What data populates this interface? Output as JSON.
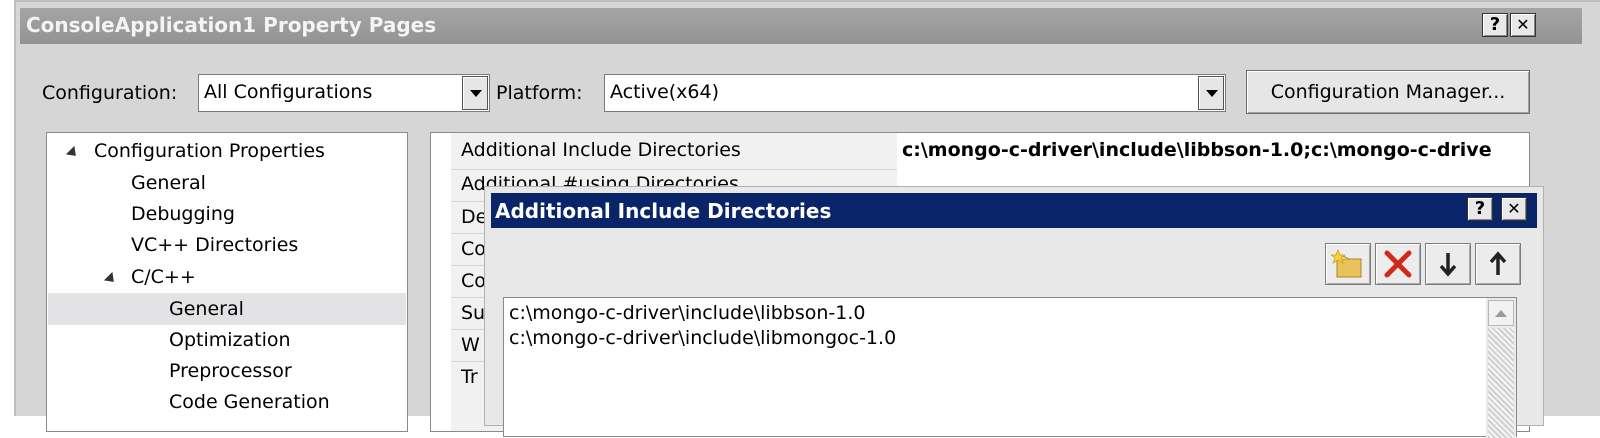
{
  "window": {
    "title": "ConsoleApplication1 Property Pages",
    "help_label": "?",
    "close_label": "✕"
  },
  "toolbar": {
    "configuration_label": "Configuration:",
    "configuration_value": "All Configurations",
    "platform_label": "Platform:",
    "platform_value": "Active(x64)",
    "config_manager_label": "Configuration Manager..."
  },
  "tree": {
    "items": [
      {
        "label": "Configuration Properties",
        "expanded": true
      },
      {
        "label": "General"
      },
      {
        "label": "Debugging"
      },
      {
        "label": "VC++ Directories"
      },
      {
        "label": "C/C++",
        "expanded": true
      },
      {
        "label": "General",
        "selected": true
      },
      {
        "label": "Optimization"
      },
      {
        "label": "Preprocessor"
      },
      {
        "label": "Code Generation"
      }
    ]
  },
  "property_grid": {
    "rows": [
      {
        "name": "Additional Include Directories",
        "value": "c:\\mongo-c-driver\\include\\libbson-1.0;c:\\mongo-c-drive"
      },
      {
        "name": "Additional #using Directories",
        "value": ""
      },
      {
        "name": "De",
        "value": ""
      },
      {
        "name": "Co",
        "value": ""
      },
      {
        "name": "Co",
        "value": ""
      },
      {
        "name": "Su",
        "value": ""
      },
      {
        "name": "W",
        "value": ""
      },
      {
        "name": "Tr",
        "value": ""
      }
    ]
  },
  "dialog": {
    "title": "Additional Include Directories",
    "help_label": "?",
    "close_label": "✕",
    "new_line_icon": "new-folder-icon",
    "delete_icon": "delete-x-icon",
    "move_down_icon": "arrow-down-icon",
    "move_up_icon": "arrow-up-icon",
    "entries": [
      "c:\\mongo-c-driver\\include\\libbson-1.0",
      "c:\\mongo-c-driver\\include\\libmongoc-1.0"
    ]
  },
  "colors": {
    "dialog_titlebar": "#0a246a",
    "window_titlebar": "#9b9b9b",
    "delete_red": "#d02a1c"
  }
}
